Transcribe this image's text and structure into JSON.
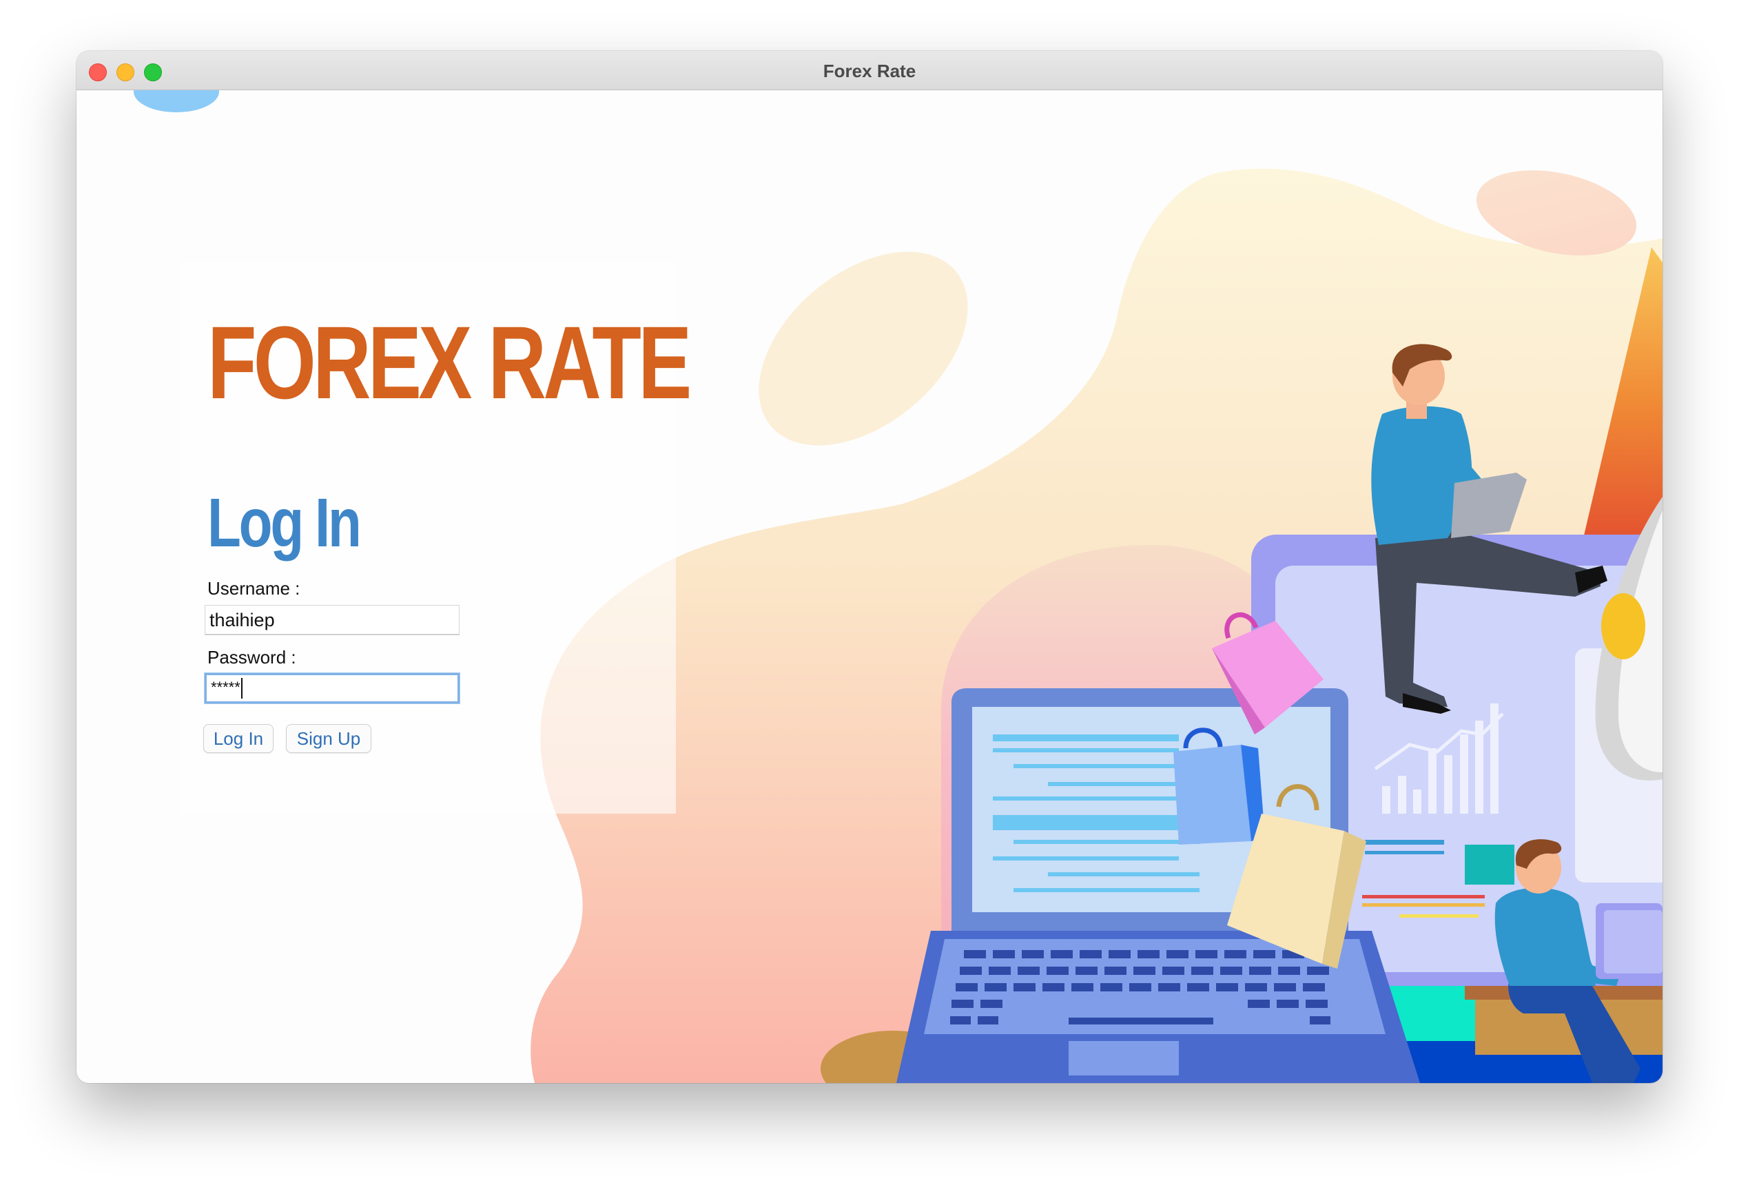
{
  "window": {
    "title": "Forex Rate"
  },
  "app": {
    "brand_title": "FOREX RATE",
    "login_heading": "Log In"
  },
  "form": {
    "username_label": "Username :",
    "username_value": "thaihiep",
    "password_label": "Password :",
    "password_value": "*****"
  },
  "buttons": {
    "login": "Log In",
    "signup": "Sign Up"
  },
  "colors": {
    "brand": "#d5621e",
    "heading": "#3f86c8",
    "link": "#2f6fb6",
    "focus": "#7fb1e6"
  }
}
